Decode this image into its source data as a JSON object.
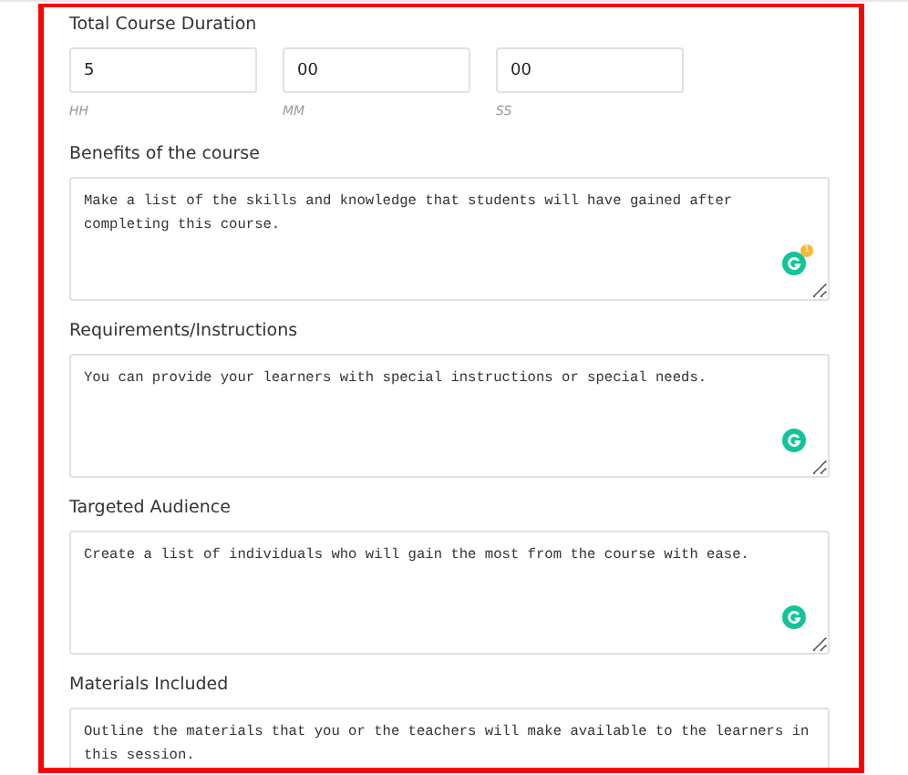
{
  "duration": {
    "label": "Total Course Duration",
    "fields": [
      {
        "value": "5",
        "caption": "HH"
      },
      {
        "value": "00",
        "caption": "MM"
      },
      {
        "value": "00",
        "caption": "SS"
      }
    ]
  },
  "sections": [
    {
      "label": "Benefits of the course",
      "placeholder": "Make a list of the skills and knowledge that students will have gained after completing this course.",
      "badge": "1"
    },
    {
      "label": "Requirements/Instructions",
      "placeholder": "You can provide your learners with special instructions or special needs."
    },
    {
      "label": "Targeted Audience",
      "placeholder": "Create a list of individuals who will gain the most from the course with ease."
    },
    {
      "label": "Materials Included",
      "placeholder": "Outline the materials that you or the teachers will make available to the learners in this session."
    }
  ]
}
